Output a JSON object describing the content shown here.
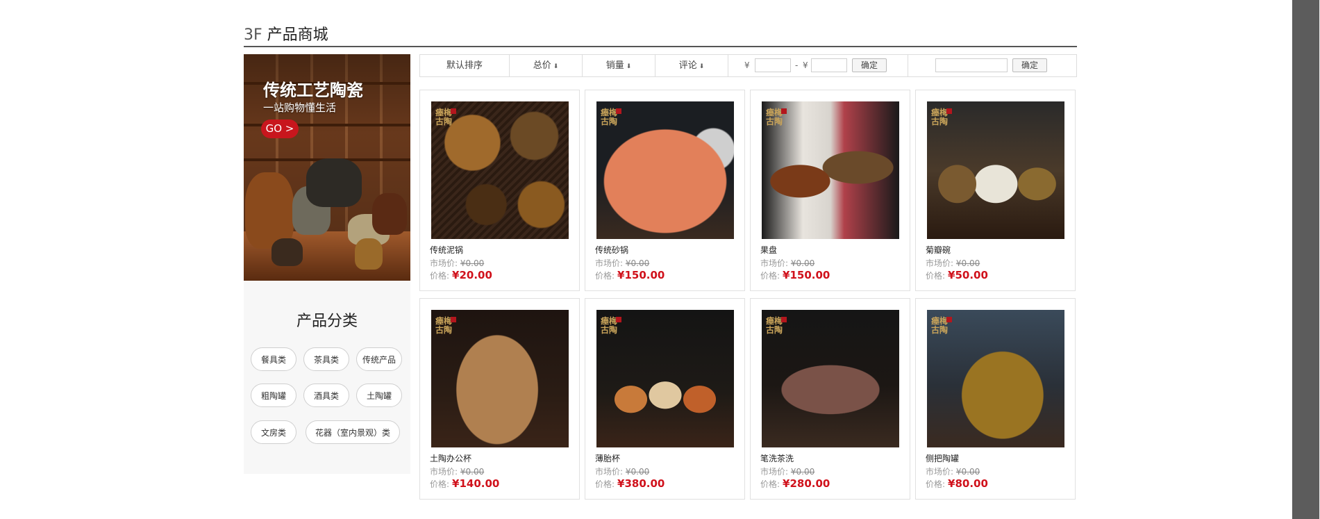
{
  "floor": {
    "number": "3F",
    "title": "产品商城"
  },
  "banner": {
    "title": "传统工艺陶瓷",
    "subtitle": "一站购物懂生活",
    "button": "GO >"
  },
  "categories": {
    "title": "产品分类",
    "items": [
      "餐具类",
      "茶具类",
      "传统产品",
      "粗陶罐",
      "酒具类",
      "土陶罐",
      "文房类",
      "花器（室内景观）类"
    ]
  },
  "sortbar": {
    "default": "默认排序",
    "total": "总价",
    "sales": "销量",
    "reviews": "评论",
    "yen": "¥",
    "dash": "-",
    "confirm": "确定",
    "confirm2": "确定"
  },
  "product_labels": {
    "market": "市场价:",
    "price": "价格:"
  },
  "brand_text": "瘗梅古陶",
  "products": [
    {
      "name": "传统泥锅",
      "market": "¥0.00",
      "price": "¥20.00"
    },
    {
      "name": "传统砂锅",
      "market": "¥0.00",
      "price": "¥150.00"
    },
    {
      "name": "果盘",
      "market": "¥0.00",
      "price": "¥150.00"
    },
    {
      "name": "菊瓣碗",
      "market": "¥0.00",
      "price": "¥50.00"
    },
    {
      "name": "土陶办公杯",
      "market": "¥0.00",
      "price": "¥140.00"
    },
    {
      "name": "薄胎杯",
      "market": "¥0.00",
      "price": "¥380.00"
    },
    {
      "name": "笔洗茶洗",
      "market": "¥0.00",
      "price": "¥280.00"
    },
    {
      "name": "侧把陶罐",
      "market": "¥0.00",
      "price": "¥80.00"
    }
  ],
  "colors": {
    "price": "#d0111b",
    "go_button": "#c8161d",
    "scrollbar": "#5c5c5c"
  },
  "icons": {
    "sort_arrow": "arrow-down-icon"
  }
}
